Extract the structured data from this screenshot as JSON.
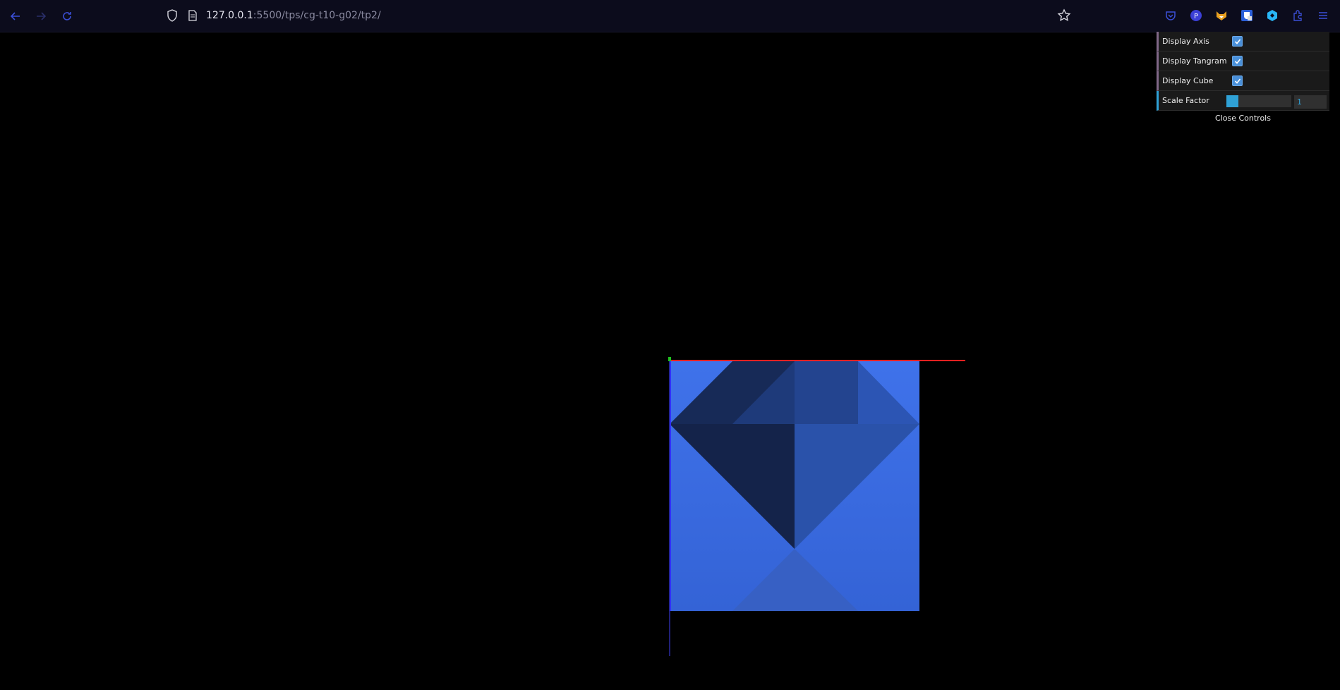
{
  "browser": {
    "url_host": "127.0.0.1",
    "url_path": ":5500/tps/cg-t10-g02/tp2/",
    "icons": {
      "back": "arrow-left-icon",
      "forward": "arrow-right-icon",
      "reload": "reload-icon",
      "tracking": "shield-icon",
      "page": "page-icon",
      "bookmark": "star-icon",
      "menu": "hamburger-menu-icon"
    },
    "extensions": [
      "pocket-icon",
      "circle-p-icon",
      "fox-icon",
      "bitwarden-icon",
      "hexagon-icon",
      "puzzle-icon"
    ]
  },
  "controls": {
    "display_axis": {
      "label": "Display Axis",
      "checked": true
    },
    "display_tangram": {
      "label": "Display Tangram",
      "checked": true
    },
    "display_cube": {
      "label": "Display Cube",
      "checked": true
    },
    "scale_factor": {
      "label": "Scale Factor",
      "value": "1",
      "fraction": 0.1
    },
    "close_label": "Close Controls"
  },
  "colors": {
    "accent_blue": "#2fa1d6",
    "cube_blue": "#3d6fe2",
    "axis_red": "#ff2020",
    "axis_green": "#20c020",
    "axis_blue": "#3030ff"
  }
}
